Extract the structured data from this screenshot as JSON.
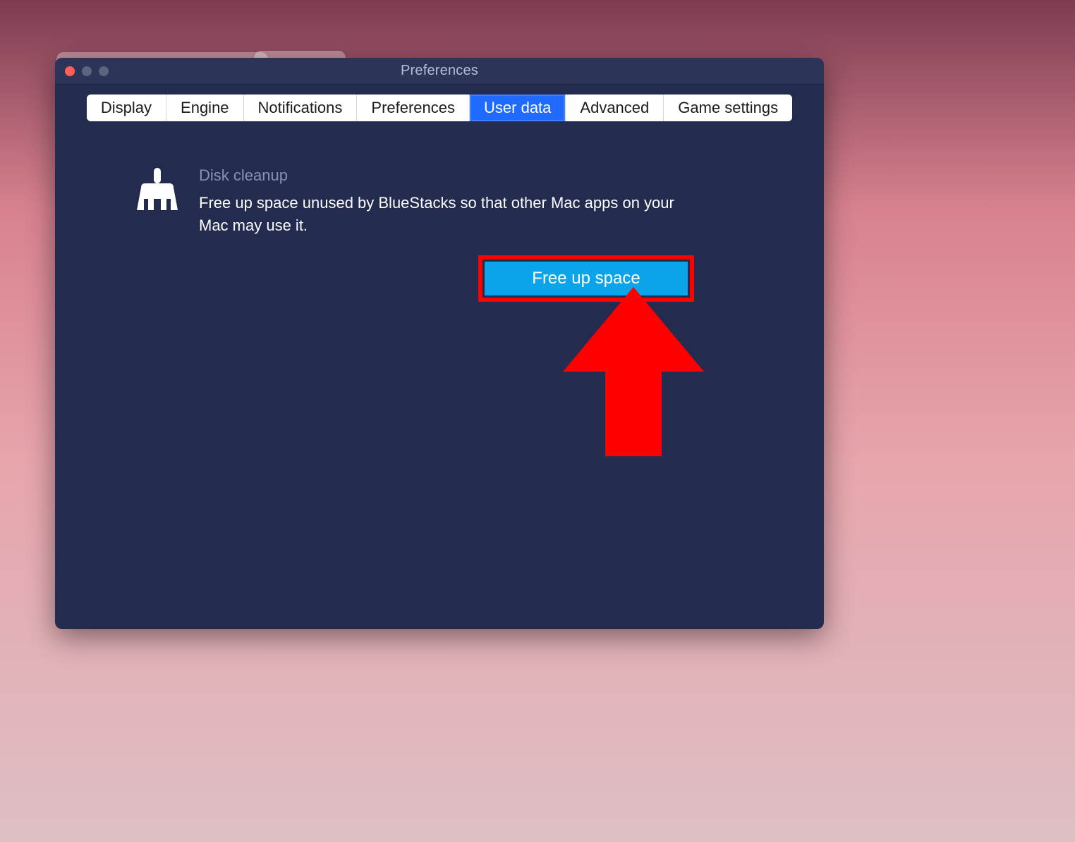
{
  "window": {
    "title": "Preferences"
  },
  "tabs": [
    {
      "id": "display",
      "label": "Display",
      "active": false
    },
    {
      "id": "engine",
      "label": "Engine",
      "active": false
    },
    {
      "id": "notifications",
      "label": "Notifications",
      "active": false
    },
    {
      "id": "preferences",
      "label": "Preferences",
      "active": false
    },
    {
      "id": "userdata",
      "label": "User data",
      "active": true
    },
    {
      "id": "advanced",
      "label": "Advanced",
      "active": false
    },
    {
      "id": "gamesettings",
      "label": "Game settings",
      "active": false
    }
  ],
  "section": {
    "title": "Disk cleanup",
    "description": "Free up space unused by BlueStacks so that other Mac apps on your Mac may use it.",
    "cta_label": "Free up space"
  },
  "annotations": {
    "highlight_color": "#ff0000"
  }
}
